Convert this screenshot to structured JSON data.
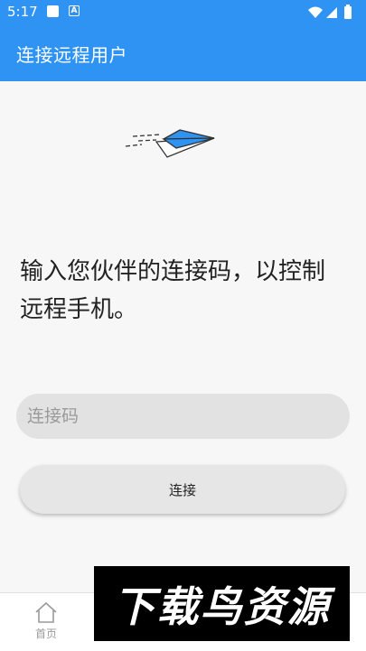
{
  "status_bar": {
    "time": "5:17",
    "icon_b": "A"
  },
  "app_bar": {
    "title": "连接远程用户"
  },
  "main": {
    "prompt": "输入您伙伴的连接码，以控制远程手机。",
    "code_input": {
      "value": "",
      "placeholder": "连接码"
    },
    "connect_label": "连接"
  },
  "bottom_nav": {
    "home_label": "首页"
  },
  "watermark": {
    "text": "下载鸟资源"
  },
  "colors": {
    "accent": "#2f93f3",
    "plane": "#2f93f3"
  }
}
